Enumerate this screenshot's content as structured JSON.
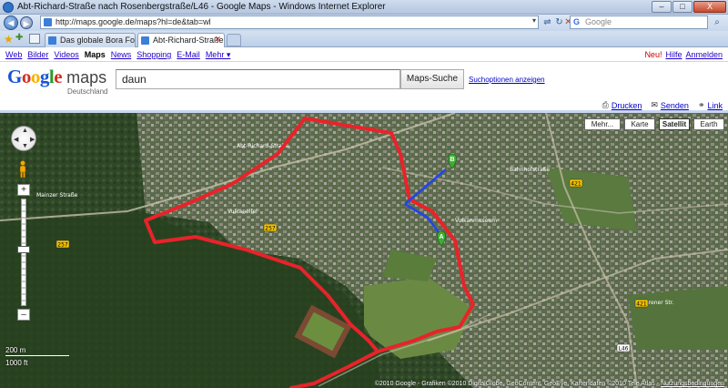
{
  "window": {
    "title": "Abt-Richard-Straße nach Rosenbergstraße/L46 - Google Maps - Windows Internet Explorer",
    "minimize": "–",
    "maximize": "□",
    "close": "X"
  },
  "address_bar": {
    "url": "http://maps.google.de/maps?hl=de&tab=wl",
    "search_engine": "Google",
    "search_placeholder": "Google"
  },
  "tabs": [
    {
      "label": "Das globale Bora Forum",
      "active": false
    },
    {
      "label": "Abt-Richard-Straße nac...",
      "active": true
    }
  ],
  "google_bar": {
    "left": [
      {
        "label": "Web",
        "current": false
      },
      {
        "label": "Bilder",
        "current": false
      },
      {
        "label": "Videos",
        "current": false
      },
      {
        "label": "Maps",
        "current": true
      },
      {
        "label": "News",
        "current": false
      },
      {
        "label": "Shopping",
        "current": false
      },
      {
        "label": "E-Mail",
        "current": false
      },
      {
        "label": "Mehr ▾",
        "current": false
      }
    ],
    "right": {
      "new": "Neu!",
      "help": "Hilfe",
      "signin": "Anmelden"
    }
  },
  "logo": {
    "google": "Google",
    "maps": "maps",
    "country": "Deutschland"
  },
  "search": {
    "query": "daun",
    "button": "Maps-Suche",
    "options": "Suchoptionen anzeigen"
  },
  "page_actions": [
    {
      "icon": "print-icon",
      "label": "Drucken"
    },
    {
      "icon": "mail-icon",
      "label": "Senden"
    },
    {
      "icon": "link-icon",
      "label": "Link"
    }
  ],
  "map": {
    "map_types": {
      "more": "Mehr...",
      "map": "Karte",
      "satellite": "Satellit",
      "earth": "Earth",
      "selected": "Satellit"
    },
    "markers": [
      {
        "letter": "A",
        "color": "#3fae33"
      },
      {
        "letter": "B",
        "color": "#3fae33"
      }
    ],
    "road_shields": [
      "257",
      "257",
      "421",
      "421",
      "L46"
    ],
    "scale_top": "200 m",
    "scale_bottom": "1000 ft",
    "copyright": "©2010 Google - Grafiken ©2010 DigitalGlobe, GeoContent, GeoEye, Kartendaten ©2010 Tele Atlas - ",
    "terms": "Nutzungsbedingungen",
    "route_color": "#e8232a",
    "walk_color": "#2244ee"
  }
}
